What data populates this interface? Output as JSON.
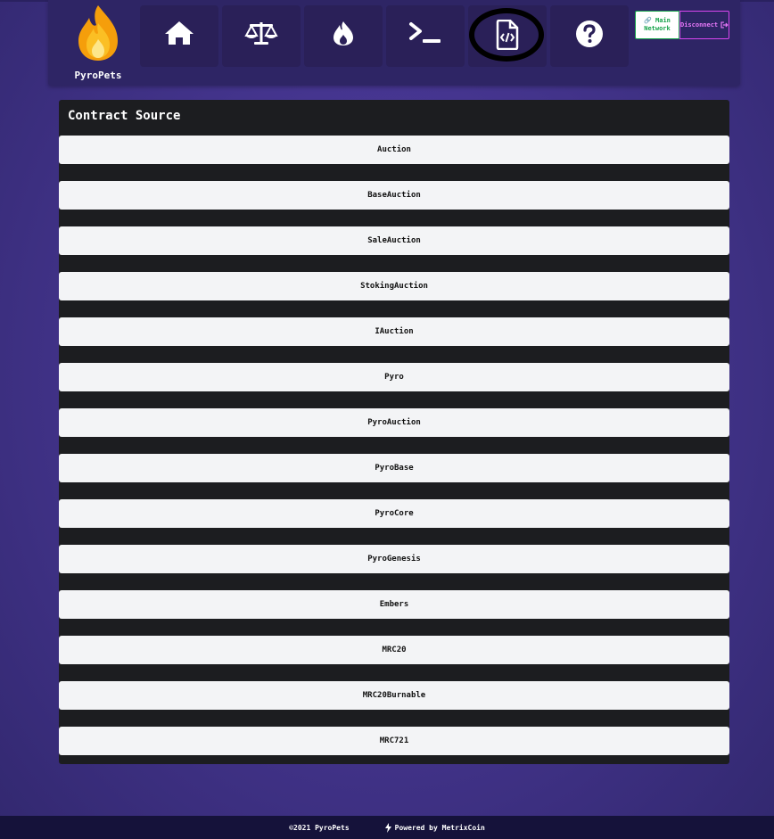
{
  "app": {
    "name": "PyroPets"
  },
  "nav": [
    {
      "name": "home-icon",
      "label": ""
    },
    {
      "name": "scale-icon",
      "label": ""
    },
    {
      "name": "flame-icon",
      "label": ""
    },
    {
      "name": "terminal-icon",
      "label": ""
    },
    {
      "name": "file-code-icon",
      "label": ""
    },
    {
      "name": "question-icon",
      "label": ""
    }
  ],
  "network": {
    "line1": "Main",
    "line2": "Network",
    "disconnect": "Disconnect"
  },
  "panel": {
    "title": "Contract Source"
  },
  "contracts": [
    "Auction",
    "BaseAuction",
    "SaleAuction",
    "StokingAuction",
    "IAuction",
    "Pyro",
    "PyroAuction",
    "PyroBase",
    "PyroCore",
    "PyroGenesis",
    "Embers",
    "MRC20",
    "MRC20Burnable",
    "MRC721"
  ],
  "footer": {
    "copyright": "©2021 PyroPets",
    "powered": "Powered by MetrixCoin"
  },
  "colors": {
    "background": "#45358f",
    "header": "#2e2565",
    "panel": "#1c1d20",
    "row": "#f3f4f6",
    "network_green": "#16a34a",
    "disconnect_pink": "#d946ef"
  }
}
